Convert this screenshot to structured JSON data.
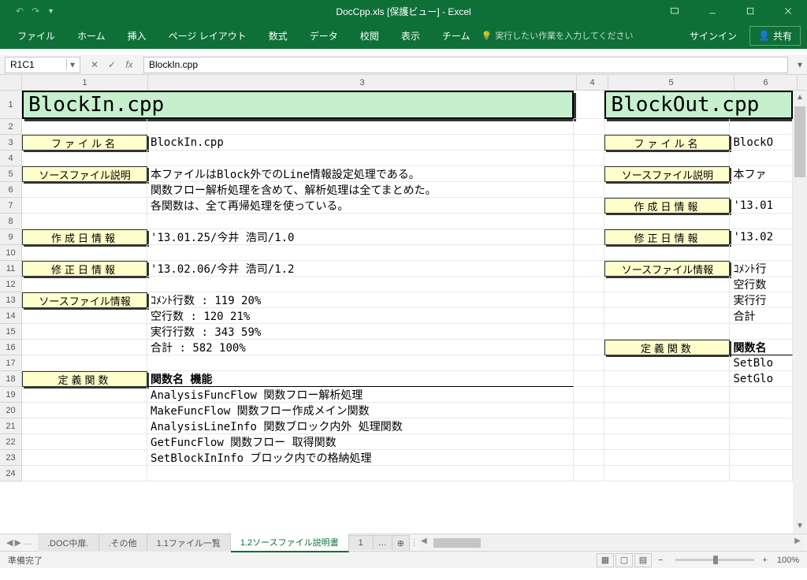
{
  "titlebar": {
    "title": "DocCpp.xls [保護ビュー] - Excel"
  },
  "ribbon": {
    "tabs": [
      "ファイル",
      "ホーム",
      "挿入",
      "ページ レイアウト",
      "数式",
      "データ",
      "校閲",
      "表示",
      "チーム"
    ],
    "tellme": "実行したい作業を入力してください",
    "signin": "サインイン",
    "share": "共有"
  },
  "formula": {
    "namebox": "R1C1",
    "fx": "fx",
    "value": "BlockIn.cpp"
  },
  "columns": [
    "1",
    "3",
    "4",
    "5",
    "6"
  ],
  "rows": [
    "1",
    "2",
    "3",
    "4",
    "5",
    "6",
    "7",
    "8",
    "9",
    "10",
    "11",
    "12",
    "13",
    "14",
    "15",
    "16",
    "17",
    "18",
    "19",
    "20",
    "21",
    "22",
    "23",
    "24"
  ],
  "doc1": {
    "title": "BlockIn.cpp",
    "labels": {
      "filename": "ファイル名",
      "source_desc": "ソースファイル説明",
      "created": "作成日情報",
      "modified": "修正日情報",
      "source_info": "ソースファイル情報",
      "def_funcs": "定義関数"
    },
    "filename_val": "BlockIn.cpp",
    "desc": [
      "本ファイルはBlock外でのLine情報設定処理である。",
      "関数フロー解析処理を含めて、解析処理は全てまとめた。",
      "各関数は、全て再帰処理を使っている。"
    ],
    "created_val": "'13.01.25/今井 浩司/1.0",
    "modified_val": "'13.02.06/今井 浩司/1.2",
    "stats": [
      "ｺﾒﾝﾄ行数 :   119   20%",
      "空行数    :   120   21%",
      "実行行数 :   343   59%",
      "合計      :   582  100%"
    ],
    "func_header": "関数名            機能",
    "funcs": [
      "AnalysisFuncFlow 関数フロー解析処理",
      "MakeFuncFlow     関数フロー作成メイン関数",
      "AnalysisLineInfo 関数ブロック内外 処理関数",
      "GetFuncFlow      関数フロー 取得関数",
      "SetBlockInInfo   ブロック内での格納処理"
    ]
  },
  "doc2": {
    "title": "BlockOut.cpp",
    "labels": {
      "filename": "ファイル名",
      "source_desc": "ソースファイル説明",
      "created": "作成日情報",
      "modified": "修正日情報",
      "source_info": "ソースファイル情報",
      "def_funcs": "定義関数"
    },
    "filename_val": "BlockO",
    "desc0": "本ファ",
    "created_val": "'13.01",
    "modified_val": "'13.02",
    "stats": [
      "ｺﾒﾝﾄ行",
      "空行数",
      "実行行",
      "合計"
    ],
    "func_header": "関数名",
    "funcs": [
      "SetBlo",
      "SetGlo"
    ]
  },
  "sheet_tabs": {
    "tabs": [
      ".DOC中扉.",
      ".その他",
      "1.1ファイル一覧",
      "1.2ソースファイル説明書",
      "1"
    ],
    "active_index": 3
  },
  "status": {
    "ready": "準備完了",
    "zoom": "100%"
  }
}
